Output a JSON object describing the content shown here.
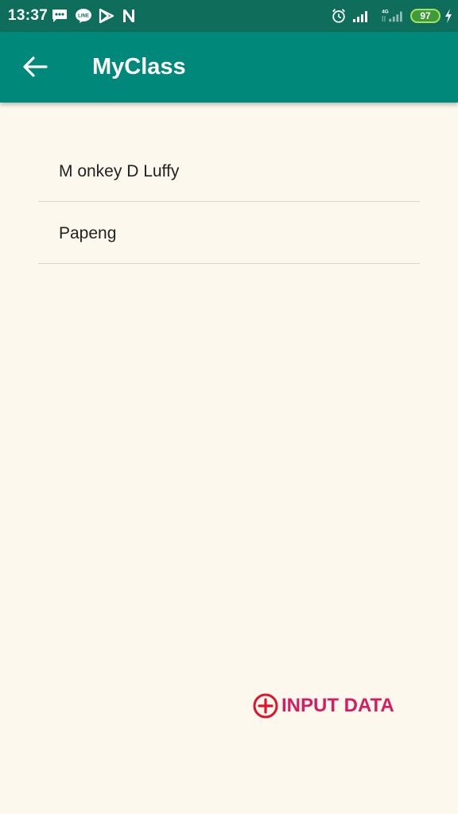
{
  "status_bar": {
    "time": "13:37",
    "battery_level": "97",
    "network_label": "4G",
    "icons": [
      "message-icon",
      "line-icon",
      "play-store-icon",
      "n-icon",
      "alarm-icon",
      "signal-icon",
      "signal-4g-icon",
      "battery-icon",
      "charging-icon"
    ]
  },
  "app_bar": {
    "title": "MyClass",
    "back_icon": "arrow-back-icon",
    "color": "#00897B"
  },
  "list": {
    "items": [
      {
        "label": "M onkey D Luffy"
      },
      {
        "label": "Papeng"
      }
    ]
  },
  "action": {
    "label": "INPUT DATA",
    "icon": "add-circle-icon",
    "color": "#D81B60"
  },
  "colors": {
    "background": "#FDF8EE",
    "status_bar": "#0F6E5B",
    "accent": "#D81B60"
  }
}
